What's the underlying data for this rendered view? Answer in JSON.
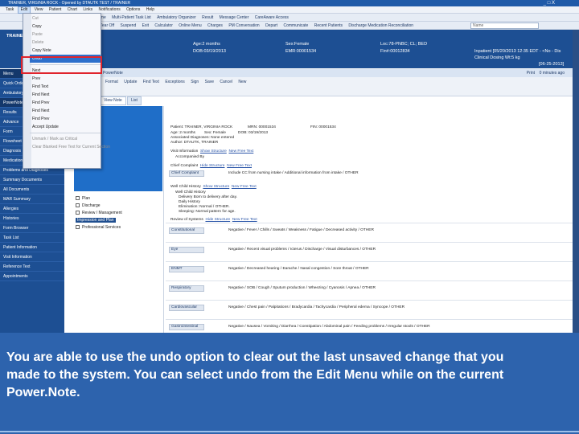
{
  "window": {
    "title": "TRAINER, VIRGINIA ROCK - Opened by DTAUTK TEST / TRAINER",
    "controls": [
      "_",
      "□",
      "X"
    ]
  },
  "menubar": {
    "items": [
      "Task",
      "Edit",
      "View",
      "Patient",
      "Chart",
      "Links",
      "Notifications",
      "Options",
      "Help"
    ],
    "active": "Edit"
  },
  "toolbar": {
    "items": [
      "Home",
      "Multi-Patient Task List",
      "Ambulatory Organizer",
      "Result",
      "Message Center",
      "CareAware Access"
    ],
    "row2": [
      "Tear Off",
      "Suspend",
      "Exit",
      "Calculator",
      "Online Menu",
      "Charges",
      "PM Conversation",
      "Depart",
      "Communicate",
      "Recent Patients",
      "Discharge Medication Reconciliation"
    ],
    "search_placeholder": "Name"
  },
  "patient": {
    "name": "TRAINER, VIRGINIA ROCK",
    "age": "Age:2 months",
    "dob": "DOB:03/19/2013",
    "sex": "Sex:Female",
    "mrn": "EMR:00001534",
    "location": "Loc:78-PNBC; CL; BED",
    "fin": "Fin#:00012834",
    "inpatient": "Inpatient [05/20/2013 12:35 EDT - <No - Dis",
    "clinical": "Clinical Dosing Wt:5 kg",
    "date": "[06-25-2013]"
  },
  "leftnav": {
    "items": [
      "Menu",
      "Quick Orders",
      "Ambulatory",
      "PowerNote",
      "Results",
      "Advance",
      "Form",
      "Flowsheet",
      "Diagnosis",
      "Medication",
      "Problems and Diagnoses",
      "Summary Documents",
      "All Documents",
      "MAR Summary",
      "Allergies",
      "Histories",
      "Form Browser",
      "Task List",
      "Patient Information",
      "Visit Information",
      "Reference Text",
      "Appointments"
    ]
  },
  "powernote": {
    "header": "PowerNote",
    "right_actions": [
      "Print",
      "0 minutes ago"
    ],
    "toolbar": [
      "Format",
      "Update",
      "Find Text",
      "Exceptions",
      "Sign",
      "Save",
      "Cancel",
      "New"
    ],
    "tabs": [
      "View Note",
      "List"
    ],
    "templates": [
      "Plan",
      "Discharge",
      "Review / Management",
      "Impression and Plan",
      "Professional Services"
    ],
    "note_lines": {
      "patient": "Patient: TRAINER, VIRGINIA ROCK",
      "mrn": "MRN: 00001534",
      "fin": "FIN: 00001534",
      "age": "Age: 2 months",
      "sex": "Sex: Female",
      "dob": "DOB: 03/19/2013",
      "assoc": "Associated Diagnoses: None entered",
      "author": "Author: DTAUTK, TRAINER",
      "visit": "Visit Information",
      "show_structure": "Show Structure",
      "new_free_text": "New Free Text",
      "acc": "Accompanied By",
      "cc": "Chief Complaint",
      "cc_links": "Hide Structure",
      "cc_text": "Include CC from nursing intake / Additional information from intake / OTHER",
      "hpi": "Well Child History",
      "hpi_lines": [
        "Well Child History",
        "Delivery Born to delivery after day.",
        "Daily History",
        "Elimination: Normal / OTHER.",
        "Sleeping: Normal pattern for age."
      ],
      "ros": "Review of Systems"
    },
    "ros_rows": [
      {
        "label": "Constitutional",
        "text": "Negative / Fever / Chills / Sweats / Weakness / Fatigue / Decreased activity / OTHER"
      },
      {
        "label": "Eye",
        "text": "Negative / Recent visual problems / Icterus / Discharge / Visual disturbances / OTHER"
      },
      {
        "label": "ENMT",
        "text": "Negative / Decreased hearing / Earache / Nasal congestion / Sore throat / OTHER"
      },
      {
        "label": "Respiratory",
        "text": "Negative / SOB / Cough / Sputum production / Wheezing / Cyanosis / Apnea / OTHER"
      },
      {
        "label": "Cardiovascular",
        "text": "Negative / Chest pain / Palpitations / Bradycardia / Tachycardia / Peripheral edema / Syncope / OTHER"
      },
      {
        "label": "Gastrointestinal",
        "text": "Negative / Nausea / Vomiting / Diarrhea / Constipation / Abdominal pain / Feeding problems / Irregular stools / OTHER"
      }
    ]
  },
  "edit_menu": {
    "items": [
      {
        "label": "Cut",
        "dim": true
      },
      {
        "label": "Copy",
        "dim": false
      },
      {
        "label": "Paste",
        "dim": true
      },
      {
        "label": "Delete",
        "dim": true
      },
      {
        "label": "Copy Note",
        "dim": false
      },
      {
        "label": "Undo",
        "dim": false
      },
      {
        "label": "Next",
        "dim": false
      },
      {
        "label": "Prev",
        "dim": false
      },
      {
        "label": "Find Text",
        "dim": false
      },
      {
        "label": "Find Next",
        "dim": false
      },
      {
        "label": "Find Prev",
        "dim": false
      },
      {
        "label": "Find Next",
        "dim": false
      },
      {
        "label": "Find Prev",
        "dim": false
      },
      {
        "label": "Accept Update",
        "dim": false
      },
      {
        "label": "Unmark / Mark as Critical",
        "dim": true
      },
      {
        "label": "Clear Blanked Free Text for Current Section",
        "dim": true
      }
    ]
  },
  "caption": {
    "line1": "You are able to use the undo option to clear out the last unsaved change that you",
    "line2": "made to the system.  You can select undo from the Edit Menu while on the current",
    "line3": "Power.Note."
  },
  "colors": {
    "banner": "#1d4f93",
    "caption_bg": "#2d63ad",
    "highlight": "#e0242c",
    "selection": "#2d6fcb"
  }
}
